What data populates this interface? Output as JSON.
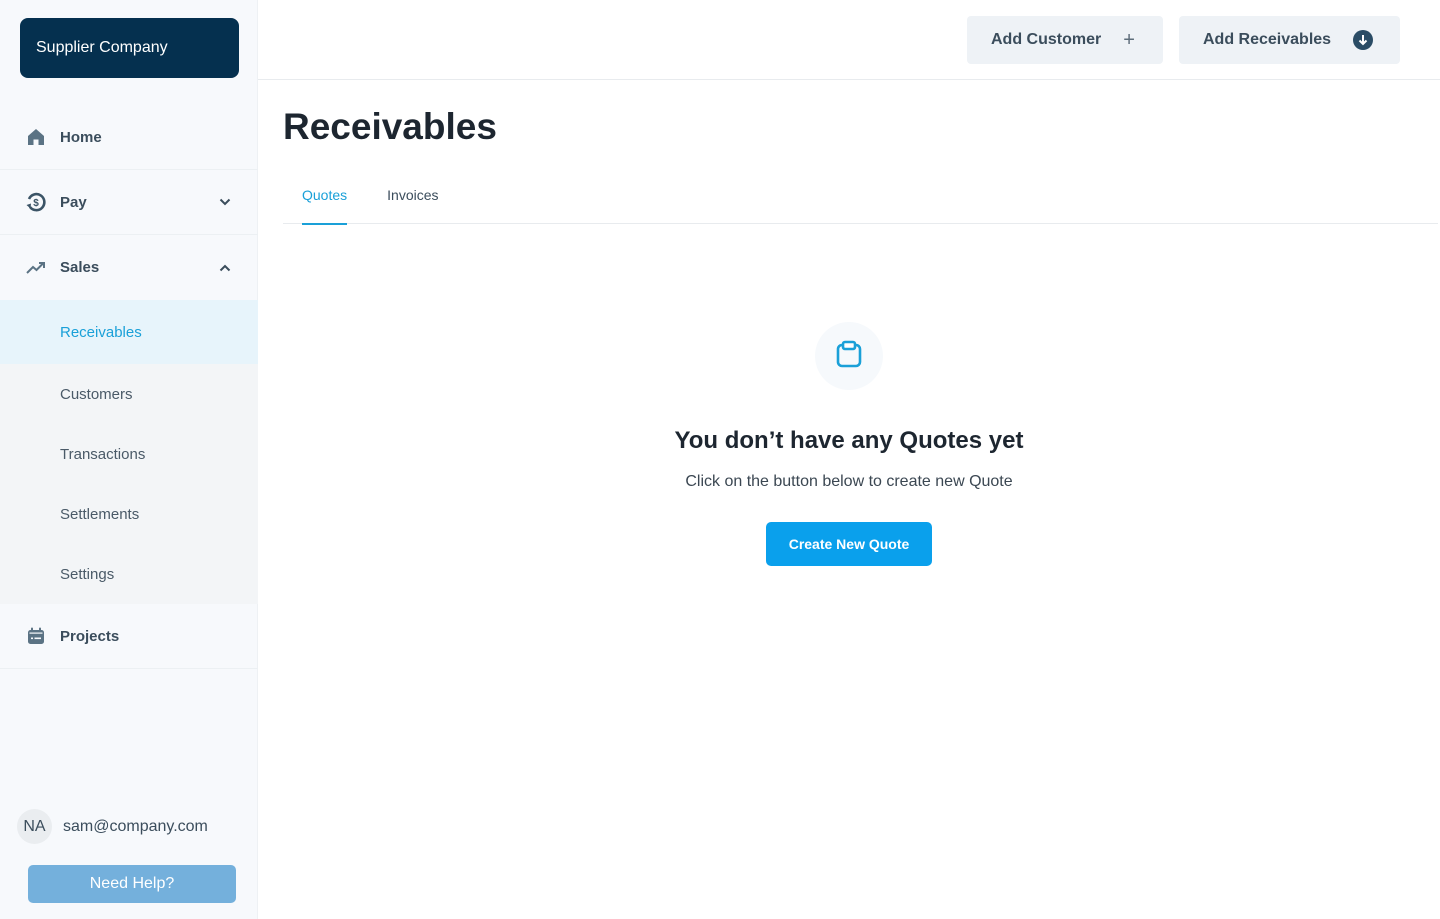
{
  "sidebar": {
    "company": "Supplier Company",
    "nav": [
      {
        "label": "Home",
        "icon": "home-icon"
      },
      {
        "label": "Pay",
        "icon": "dollar-cycle-icon",
        "expanded": false
      },
      {
        "label": "Sales",
        "icon": "trending-up-icon",
        "expanded": true
      }
    ],
    "sales_submenu": [
      {
        "label": "Receivables",
        "active": true
      },
      {
        "label": "Customers"
      },
      {
        "label": "Transactions"
      },
      {
        "label": "Settlements"
      },
      {
        "label": "Settings"
      }
    ],
    "projects": {
      "label": "Projects",
      "icon": "calendar-icon"
    },
    "user": {
      "initials": "NA",
      "email": "sam@company.com"
    },
    "help_label": "Need Help?"
  },
  "topbar": {
    "add_customer_label": "Add Customer",
    "add_receivables_label": "Add Receivables"
  },
  "main": {
    "title": "Receivables",
    "tabs": [
      {
        "label": "Quotes",
        "active": true
      },
      {
        "label": "Invoices",
        "active": false
      }
    ],
    "empty_state": {
      "icon": "clipboard-icon",
      "title": "You don’t have any Quotes yet",
      "subtitle": "Click on the button below to create new Quote",
      "button_label": "Create New Quote"
    }
  },
  "colors": {
    "brand_dark": "#05304f",
    "accent": "#1aa0d8",
    "primary_button": "#0aa0ec",
    "help_button": "#74b0dc"
  }
}
